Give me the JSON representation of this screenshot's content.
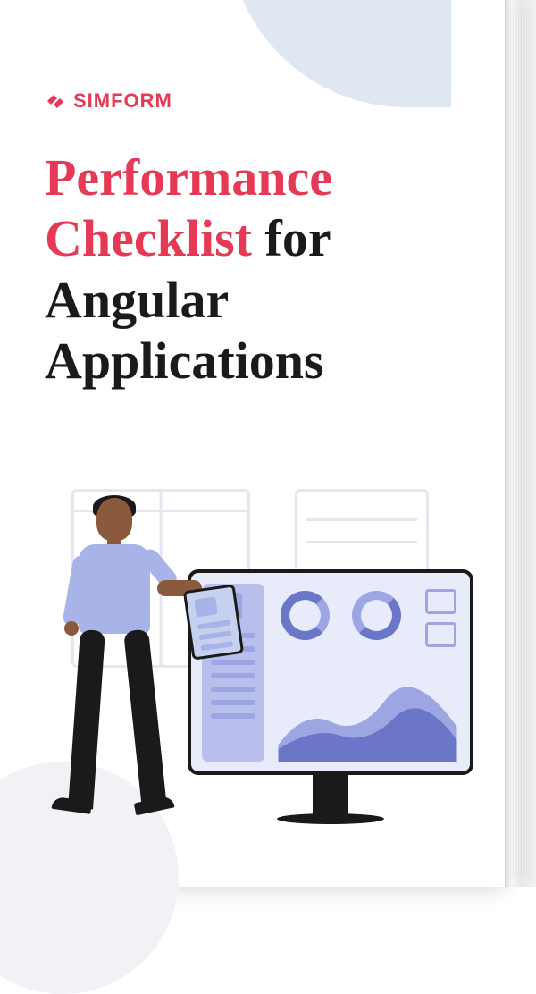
{
  "logo": {
    "brand": "SIMFORM"
  },
  "title": {
    "highlight": "Performance Checklist",
    "connector": " for ",
    "normal": "Angular Applications"
  },
  "illustration": {
    "description": "Person standing next to analytics dashboard on monitor"
  },
  "colors": {
    "brand": "#E63956",
    "textDark": "#1a1a1a",
    "accentLight": "#DFE8F1",
    "illustrationPrimary": "#A8B4E8",
    "illustrationSecondary": "#6B76C9"
  }
}
